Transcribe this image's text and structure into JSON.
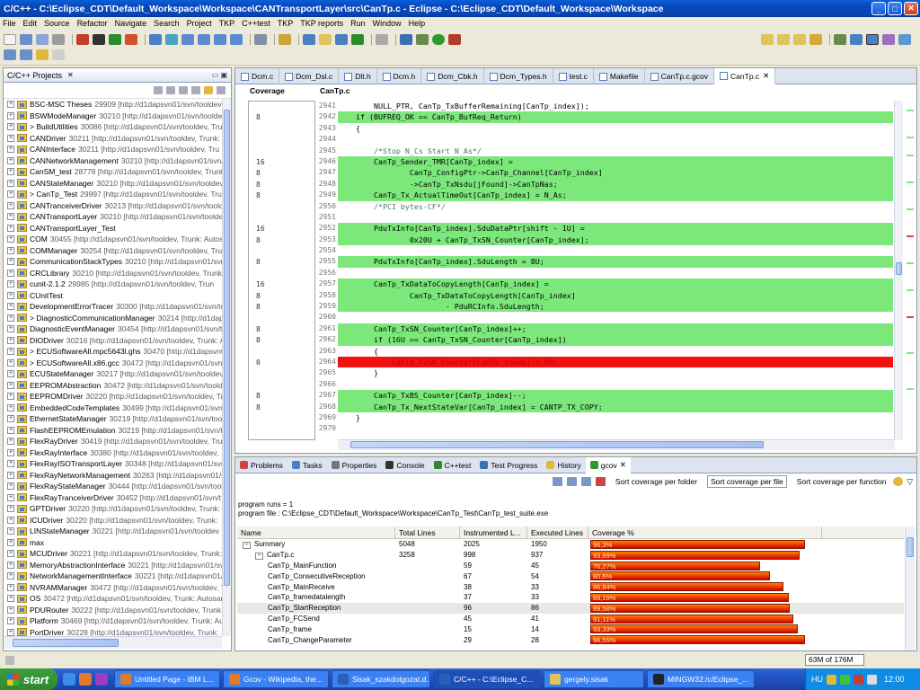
{
  "window": {
    "title": "C/C++ - C:\\Eclipse_CDT\\Default_Workspace\\Workspace\\CANTransportLayer\\src\\CanTp.c - Eclipse - C:\\Eclipse_CDT\\Default_Workspace\\Workspace",
    "minimize": "_",
    "maximize": "□",
    "close": "✕"
  },
  "menu": [
    "File",
    "Edit",
    "Source",
    "Refactor",
    "Navigate",
    "Search",
    "Project",
    "TKP",
    "C++test",
    "TKP",
    "TKP reports",
    "Run",
    "Window",
    "Help"
  ],
  "project_panel": {
    "tab_label": "C/C++ Projects",
    "items": [
      {
        "name": "BSC-MSC Theses",
        "rev": "29909 [http://d1dapsvn01/svn/tooldev"
      },
      {
        "name": "BSWModeManager",
        "rev": "30210 [http://d1dapsvn01/svn/tooldev"
      },
      {
        "name": "> BuildUtilities",
        "rev": "30086 [http://d1dapsvn01/svn/tooldev, Tru"
      },
      {
        "name": "CANDriver",
        "rev": "30211 [http://d1dapsvn01/svn/tooldev, Trunk:"
      },
      {
        "name": "CANInterface",
        "rev": "30211 [http://d1dapsvn01/svn/tooldev, Tru"
      },
      {
        "name": "CANNetworkManagement",
        "rev": "30210 [http://d1dapsvn01/svn/too"
      },
      {
        "name": "CanSM_test",
        "rev": "28778 [http://d1dapsvn01/svn/tooldev, Trunk"
      },
      {
        "name": "CANStateManager",
        "rev": "30210 [http://d1dapsvn01/svn/tooldev"
      },
      {
        "name": "> CanTp_Test",
        "rev": "29997 [http://d1dapsvn01/svn/tooldev, Tru"
      },
      {
        "name": "CANTranceiverDriver",
        "rev": "30213 [http://d1dapsvn01/svn/toold"
      },
      {
        "name": "CANTransportLayer",
        "rev": "30210 [http://d1dapsvn01/svn/toolde"
      },
      {
        "name": "CANTransportLayer_Test",
        "rev": ""
      },
      {
        "name": "COM",
        "rev": "30455 [http://d1dapsvn01/svn/tooldev, Trunk: Autos"
      },
      {
        "name": "COMManager",
        "rev": "30254 [http://d1dapsvn01/svn/tooldev, Trunk"
      },
      {
        "name": "CommunicationStackTypes",
        "rev": "30210 [http://d1dapsvn01/svn/"
      },
      {
        "name": "CRCLibrary",
        "rev": "30210 [http://d1dapsvn01/svn/tooldev, Trunk:"
      },
      {
        "name": "cunit-2.1.2",
        "rev": "29985 [http://d1dapsvn01/svn/tooldev, Trun"
      },
      {
        "name": "CUnitTest",
        "rev": ""
      },
      {
        "name": "DevelopmentErrorTracer",
        "rev": "30300 [http://d1dapsvn01/svn/to"
      },
      {
        "name": "> DiagnosticCommunicationManager",
        "rev": "30214 [http://d1daps"
      },
      {
        "name": "DiagnosticEventManager",
        "rev": "30454 [http://d1dapsvn01/svn/to"
      },
      {
        "name": "DIODriver",
        "rev": "30216 [http://d1dapsvn01/svn/tooldev, Trunk: A"
      },
      {
        "name": "> ECUSoftwareAll.mpc5643l.ghs",
        "rev": "30470 [http://d1dapsvn0"
      },
      {
        "name": "> ECUSoftwareAll.x86.gcc",
        "rev": "30472 [http://d1dapsvn01/svn/t"
      },
      {
        "name": "ECUStateManager",
        "rev": "30217 [http://d1dapsvn01/svn/tooldev"
      },
      {
        "name": "EEPROMAbstraction",
        "rev": "30472 [http://d1dapsvn01/svn/toolde"
      },
      {
        "name": "EEPROMDriver",
        "rev": "30220 [http://d1dapsvn01/svn/tooldev, Tru"
      },
      {
        "name": "EmbeddedCodeTemplates",
        "rev": "30499 [http://d1dapsvn01/svn/t"
      },
      {
        "name": "EthernetStateManager",
        "rev": "30219 [http://d1dapsvn01/svn/too"
      },
      {
        "name": "FlashEEPROMEmulation",
        "rev": "30219 [http://d1dapsvn01/svn/too"
      },
      {
        "name": "FlexRayDriver",
        "rev": "30419 [http://d1dapsvn01/svn/tooldev, Tru"
      },
      {
        "name": "FlexRayInterface",
        "rev": "30380 [http://d1dapsvn01/svn/tooldev,"
      },
      {
        "name": "FlexRayISOTransportLayer",
        "rev": "30348 [http://d1dapsvn01/svn/"
      },
      {
        "name": "FlexRayNetworkManagement",
        "rev": "30263 [http://d1dapsvn01/svn"
      },
      {
        "name": "FlexRayStateManager",
        "rev": "30444 [http://d1dapsvn01/svn/tool"
      },
      {
        "name": "FlexRayTranceiverDriver",
        "rev": "30452 [http://d1dapsvn01/svn/t"
      },
      {
        "name": "GPTDriver",
        "rev": "30220 [http://d1dapsvn01/svn/tooldev, Trunk:"
      },
      {
        "name": "ICUDriver",
        "rev": "30220 [http://d1dapsvn01/svn/tooldev, Trunk:"
      },
      {
        "name": "LINStateManager",
        "rev": "30221 [http://d1dapsvn01/svn/tooldev"
      },
      {
        "name": "max",
        "rev": ""
      },
      {
        "name": "MCUDriver",
        "rev": "30221 [http://d1dapsvn01/svn/tooldev, Trunk:"
      },
      {
        "name": "MemoryAbstractionInterface",
        "rev": "30221 [http://d1dapsvn01/sv"
      },
      {
        "name": "NetworkManagementInterface",
        "rev": "30221 [http://d1dapsvn01/"
      },
      {
        "name": "NVRAMManager",
        "rev": "30472 [http://d1dapsvn01/svn/tooldev, T"
      },
      {
        "name": "OS",
        "rev": "30472 [http://d1dapsvn01/svn/tooldev, Trunk: Autosar"
      },
      {
        "name": "PDURouter",
        "rev": "30222 [http://d1dapsvn01/svn/tooldev, Trunk:"
      },
      {
        "name": "Platform",
        "rev": "30469 [http://d1dapsvn01/svn/tooldev, Trunk: Au"
      },
      {
        "name": "PortDriver",
        "rev": "30228 [http://d1dapsvn01/svn/tooldev, Trunk:"
      }
    ]
  },
  "editor": {
    "tabs": [
      "Dcm.c",
      "Dcm_Dsl.c",
      "Dlt.h",
      "Dcm.h",
      "Dcm_Cbk.h",
      "Dcm_Types.h",
      "test.c",
      "Makefile",
      "CanTp.c.gcov",
      "CanTp.c"
    ],
    "active_tab": "CanTp.c",
    "col_coverage": "Coverage",
    "col_file": "CanTp.c",
    "lines": [
      {
        "n": "2941",
        "cov": "",
        "code": "        NULL_PTR, CanTp_TxBufferRemaining[CanTp_index]);",
        "hl": ""
      },
      {
        "n": "2942",
        "cov": "8",
        "code": "    if (BUFREQ_OK == CanTp_BufReq_Return)",
        "hl": "g"
      },
      {
        "n": "2943",
        "cov": "",
        "code": "    {",
        "hl": ""
      },
      {
        "n": "2944",
        "cov": "",
        "code": "",
        "hl": ""
      },
      {
        "n": "2945",
        "cov": "",
        "code": "        /*Stop N_Cs Start N_As*/",
        "hl": ""
      },
      {
        "n": "2946",
        "cov": "16",
        "code": "        CanTp_Sender_TMR[CanTp_index] =",
        "hl": "g"
      },
      {
        "n": "2947",
        "cov": "8",
        "code": "                CanTp_ConfigPtr->CanTp_Channel[CanTp_index]",
        "hl": "g"
      },
      {
        "n": "2948",
        "cov": "8",
        "code": "                ->CanTp_TxNsdu[jFound]->CanTpNas;",
        "hl": "g"
      },
      {
        "n": "2949",
        "cov": "8",
        "code": "        CanTp_Tx_ActualTimeOut[CanTp_index] = N_As;",
        "hl": "g"
      },
      {
        "n": "2950",
        "cov": "",
        "code": "        /*PCI bytes-CF*/",
        "hl": ""
      },
      {
        "n": "2951",
        "cov": "",
        "code": "",
        "hl": ""
      },
      {
        "n": "2952",
        "cov": "16",
        "code": "        PduTxInfo[CanTp_index].SduDataPtr[shift - 1U] =",
        "hl": "g"
      },
      {
        "n": "2953",
        "cov": "8",
        "code": "                0x20U + CanTp_TxSN_Counter[CanTp_index];",
        "hl": "g"
      },
      {
        "n": "2954",
        "cov": "",
        "code": "",
        "hl": ""
      },
      {
        "n": "2955",
        "cov": "8",
        "code": "        PduTxInfo[CanTp_index].SduLength = 8U;",
        "hl": "g"
      },
      {
        "n": "2956",
        "cov": "",
        "code": "",
        "hl": ""
      },
      {
        "n": "2957",
        "cov": "16",
        "code": "        CanTp_TxDataToCopyLength[CanTp_index] =",
        "hl": "g"
      },
      {
        "n": "2958",
        "cov": "8",
        "code": "                CanTp_TxDataToCopyLength[CanTp_index]",
        "hl": "g"
      },
      {
        "n": "2959",
        "cov": "8",
        "code": "                        - PduRCInfo.SduLength;",
        "hl": "g"
      },
      {
        "n": "2960",
        "cov": "",
        "code": "",
        "hl": ""
      },
      {
        "n": "2961",
        "cov": "8",
        "code": "        CanTp_TxSN_Counter[CanTp_index]++;",
        "hl": "g"
      },
      {
        "n": "2962",
        "cov": "8",
        "code": "        if (16U == CanTp_TxSN_Counter[CanTp_index])",
        "hl": "g"
      },
      {
        "n": "2963",
        "cov": "",
        "code": "        {",
        "hl": ""
      },
      {
        "n": "2964",
        "cov": "0",
        "code": "            CanTp_TxSN_Counter[CanTp_index] = 0U;",
        "hl": "r"
      },
      {
        "n": "2965",
        "cov": "",
        "code": "        }",
        "hl": ""
      },
      {
        "n": "2966",
        "cov": "",
        "code": "",
        "hl": ""
      },
      {
        "n": "2967",
        "cov": "8",
        "code": "        CanTp_TxBS_Counter[CanTp_index]--;",
        "hl": "g"
      },
      {
        "n": "2968",
        "cov": "8",
        "code": "        CanTp_Tx_NextStateVar[CanTp_index] = CANTP_TX_COPY;",
        "hl": "g"
      },
      {
        "n": "2969",
        "cov": "",
        "code": "    }",
        "hl": ""
      },
      {
        "n": "2970",
        "cov": "",
        "code": "",
        "hl": ""
      }
    ]
  },
  "bottom_panel": {
    "tabs": [
      "Problems",
      "Tasks",
      "Properties",
      "Console",
      "C++test",
      "Test Progress",
      "History",
      "gcov"
    ],
    "active_tab": "gcov",
    "sort_folder": "Sort coverage per folder",
    "sort_file": "Sort coverage per file",
    "sort_function": "Sort coverage per function",
    "program_runs": "program runs = 1",
    "program_file": "program file : C:\\Eclipse_CDT\\Default_Workspace\\Workspace\\CanTp_Test\\CanTp_test_suite.exe",
    "columns": [
      "Name",
      "Total Lines",
      "Instrumented L...",
      "Executed Lines",
      "Coverage %"
    ],
    "rows": [
      {
        "name": "Summary",
        "total": "5048",
        "instr": "2025",
        "exec": "1950",
        "cov": "96,3%",
        "pct": 96.3,
        "level": 0
      },
      {
        "name": "CanTp.c",
        "total": "3258",
        "instr": "998",
        "exec": "937",
        "cov": "93,89%",
        "pct": 93.89,
        "level": 1
      },
      {
        "name": "CanTp_MainFunction",
        "total": "",
        "instr": "59",
        "exec": "45",
        "cov": "76,27%",
        "pct": 76.27,
        "level": 2
      },
      {
        "name": "CanTp_ConsecutiveReception",
        "total": "",
        "instr": "67",
        "exec": "54",
        "cov": "80,6%",
        "pct": 80.6,
        "level": 2
      },
      {
        "name": "CanTp_MainReceive",
        "total": "",
        "instr": "38",
        "exec": "33",
        "cov": "86,84%",
        "pct": 86.84,
        "level": 2
      },
      {
        "name": "CanTp_framedatalength",
        "total": "",
        "instr": "37",
        "exec": "33",
        "cov": "89,19%",
        "pct": 89.19,
        "level": 2
      },
      {
        "name": "CanTp_StartReception",
        "total": "",
        "instr": "96",
        "exec": "86",
        "cov": "89,58%",
        "pct": 89.58,
        "level": 2
      },
      {
        "name": "CanTp_FCSend",
        "total": "",
        "instr": "45",
        "exec": "41",
        "cov": "91,11%",
        "pct": 91.11,
        "level": 2
      },
      {
        "name": "CanTp_frame",
        "total": "",
        "instr": "15",
        "exec": "14",
        "cov": "93,33%",
        "pct": 93.33,
        "level": 2
      },
      {
        "name": "CanTp_ChangeParameter",
        "total": "",
        "instr": "29",
        "exec": "28",
        "cov": "96,55%",
        "pct": 96.55,
        "level": 2
      }
    ]
  },
  "status": {
    "memory": "63M of 176M"
  },
  "taskbar": {
    "start": "start",
    "tasks": [
      "Untitled Page - IBM L...",
      "Gcov - Wikipedia, the...",
      "Sisak_szakdolgozat.d...",
      "C/C++ - C:\\Eclipse_C...",
      "gergely.sisak",
      "MINGW32:/c/Eclipse_..."
    ],
    "active_task": "C/C++ - C:\\Eclipse_C...",
    "lang": "HU",
    "clock": "12:00"
  },
  "colors": {
    "covered": "#7ce87c",
    "uncovered": "#f21010",
    "bar": "#e83a00"
  }
}
